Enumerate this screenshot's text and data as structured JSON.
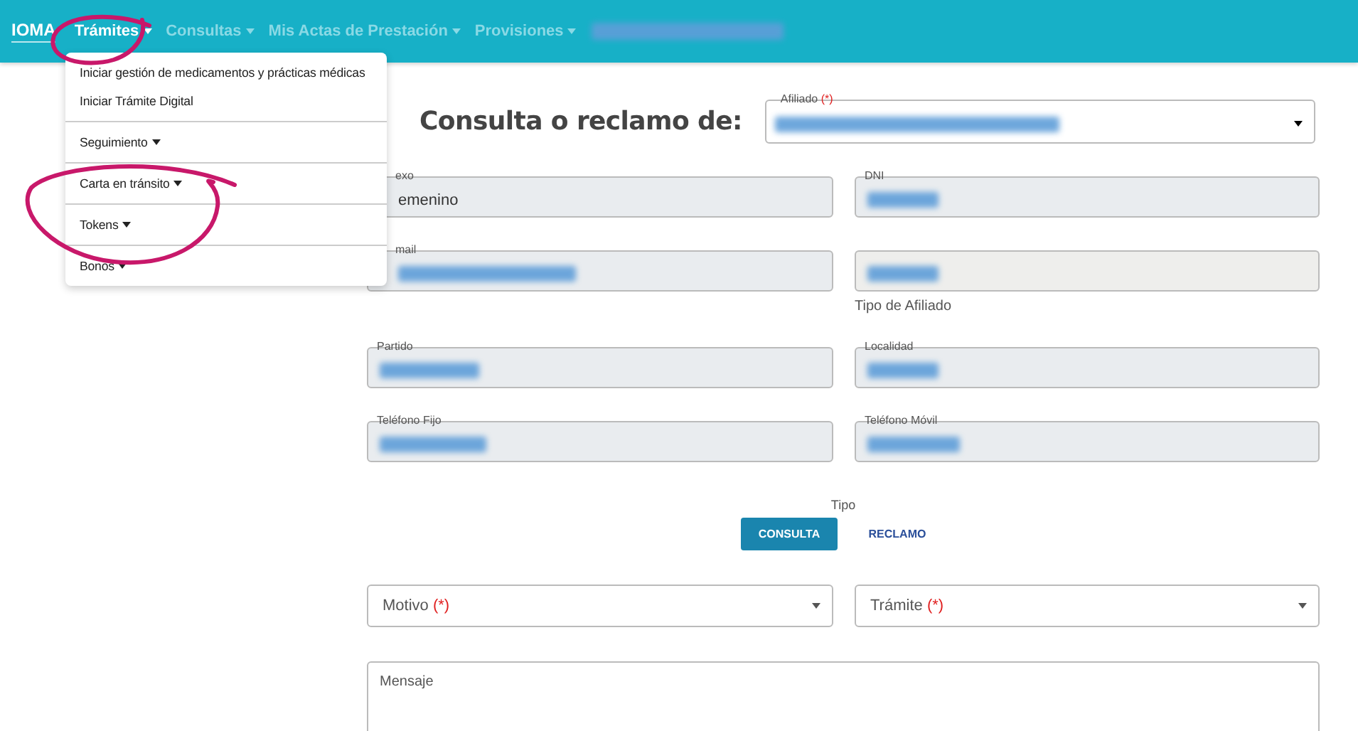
{
  "navbar": {
    "logo": "IOMA",
    "items": [
      {
        "label": "Trámites",
        "selected": true,
        "redacted": false
      },
      {
        "label": "Consultas",
        "selected": false,
        "redacted": false
      },
      {
        "label": "Mis Actas de Prestación",
        "selected": false,
        "redacted": false
      },
      {
        "label": "Provisiones",
        "selected": false,
        "redacted": false
      },
      {
        "redacted": true
      }
    ]
  },
  "dropdown": {
    "sections": [
      [
        {
          "label": "Iniciar gestión de medicamentos y prácticas médicas"
        },
        {
          "label": "Iniciar Trámite Digital"
        }
      ],
      [
        {
          "label": "Seguimiento",
          "submenu": true
        }
      ],
      [
        {
          "label": "Carta en tránsito",
          "submenu": true
        }
      ],
      [
        {
          "label": "Tokens",
          "submenu": true
        }
      ],
      [
        {
          "label": "Bonos",
          "submenu": true
        }
      ]
    ]
  },
  "title": "Consulta o reclamo de:",
  "affiliate_select": {
    "label": "Afiliado",
    "required_mark": "(*)",
    "value_redacted": true
  },
  "fields": [
    {
      "label": "exo",
      "value": "emenino",
      "value_redacted": false,
      "covered": true
    },
    {
      "label": "DNI",
      "value_redacted": true,
      "covered": false
    },
    {
      "label": "mail",
      "value_redacted": true,
      "covered": true
    },
    {
      "value_redacted": true,
      "covered": false,
      "hint": "Tipo de Afiliado"
    },
    {
      "label": "Partido",
      "value_redacted": true,
      "covered": false
    },
    {
      "label": "Localidad",
      "value_redacted": true,
      "covered": false
    },
    {
      "label": "Teléfono Fijo",
      "value_redacted": true,
      "covered": false
    },
    {
      "label": "Teléfono Móvil",
      "value_redacted": true,
      "covered": false
    }
  ],
  "tipo": {
    "label": "Tipo",
    "options": [
      {
        "label": "CONSULTA",
        "selected": true
      },
      {
        "label": "RECLAMO",
        "selected": false
      }
    ]
  },
  "selects": [
    {
      "placeholder": "Motivo",
      "required_mark": "(*)"
    },
    {
      "placeholder": "Trámite",
      "required_mark": "(*)"
    }
  ],
  "message": {
    "placeholder": "Mensaje"
  }
}
